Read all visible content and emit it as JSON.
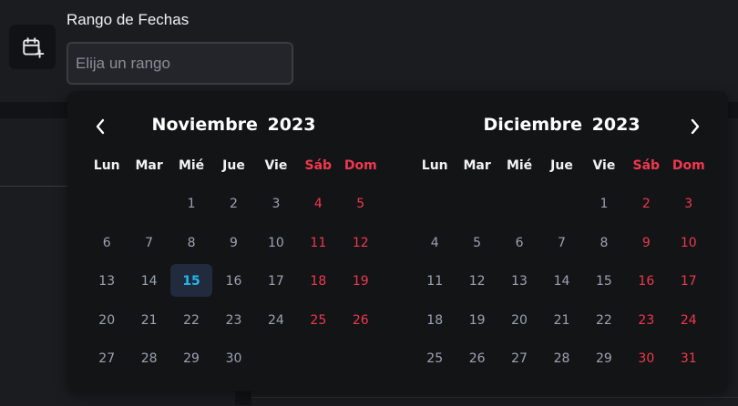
{
  "field": {
    "label": "Rango de Fechas",
    "placeholder": "Elija un rango",
    "value": ""
  },
  "icons": {
    "field_icon": "calendar-plus-icon",
    "prev": "chevron-left-icon",
    "next": "chevron-right-icon"
  },
  "colors": {
    "weekend": "#f0384f",
    "today": "#22b8ec",
    "today_bg": "#212b3d",
    "day_text": "#9aa3b2"
  },
  "calendar": {
    "weekdays": [
      "Lun",
      "Mar",
      "Mié",
      "Jue",
      "Vie",
      "Sáb",
      "Dom"
    ],
    "months": [
      {
        "title": "Noviembre  2023",
        "offset": 2,
        "days": 30,
        "today": 15
      },
      {
        "title": "Diciembre  2023",
        "offset": 4,
        "days": 31,
        "today": null
      }
    ]
  }
}
